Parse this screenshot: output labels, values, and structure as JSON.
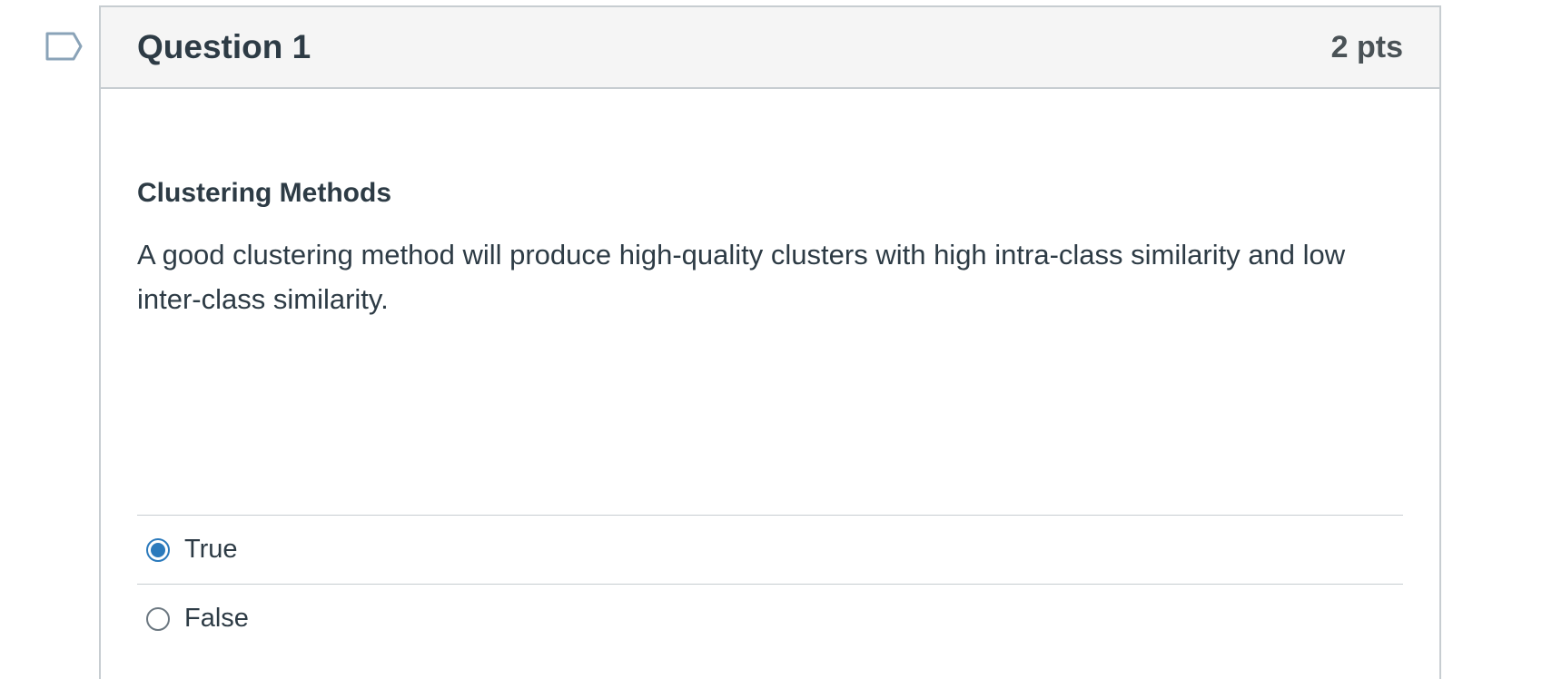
{
  "flag": {
    "icon": "bookmark-flag-icon"
  },
  "question": {
    "title": "Question 1",
    "points": "2 pts",
    "subtitle": "Clustering Methods",
    "text": "A good clustering method will produce high-quality clusters with high intra-class similarity and low inter-class similarity."
  },
  "answers": [
    {
      "label": "True",
      "selected": true
    },
    {
      "label": "False",
      "selected": false
    }
  ],
  "colors": {
    "accent": "#2b7abc",
    "header_bg": "#f5f5f5",
    "border": "#c7cdd1",
    "text": "#2d3b45"
  }
}
